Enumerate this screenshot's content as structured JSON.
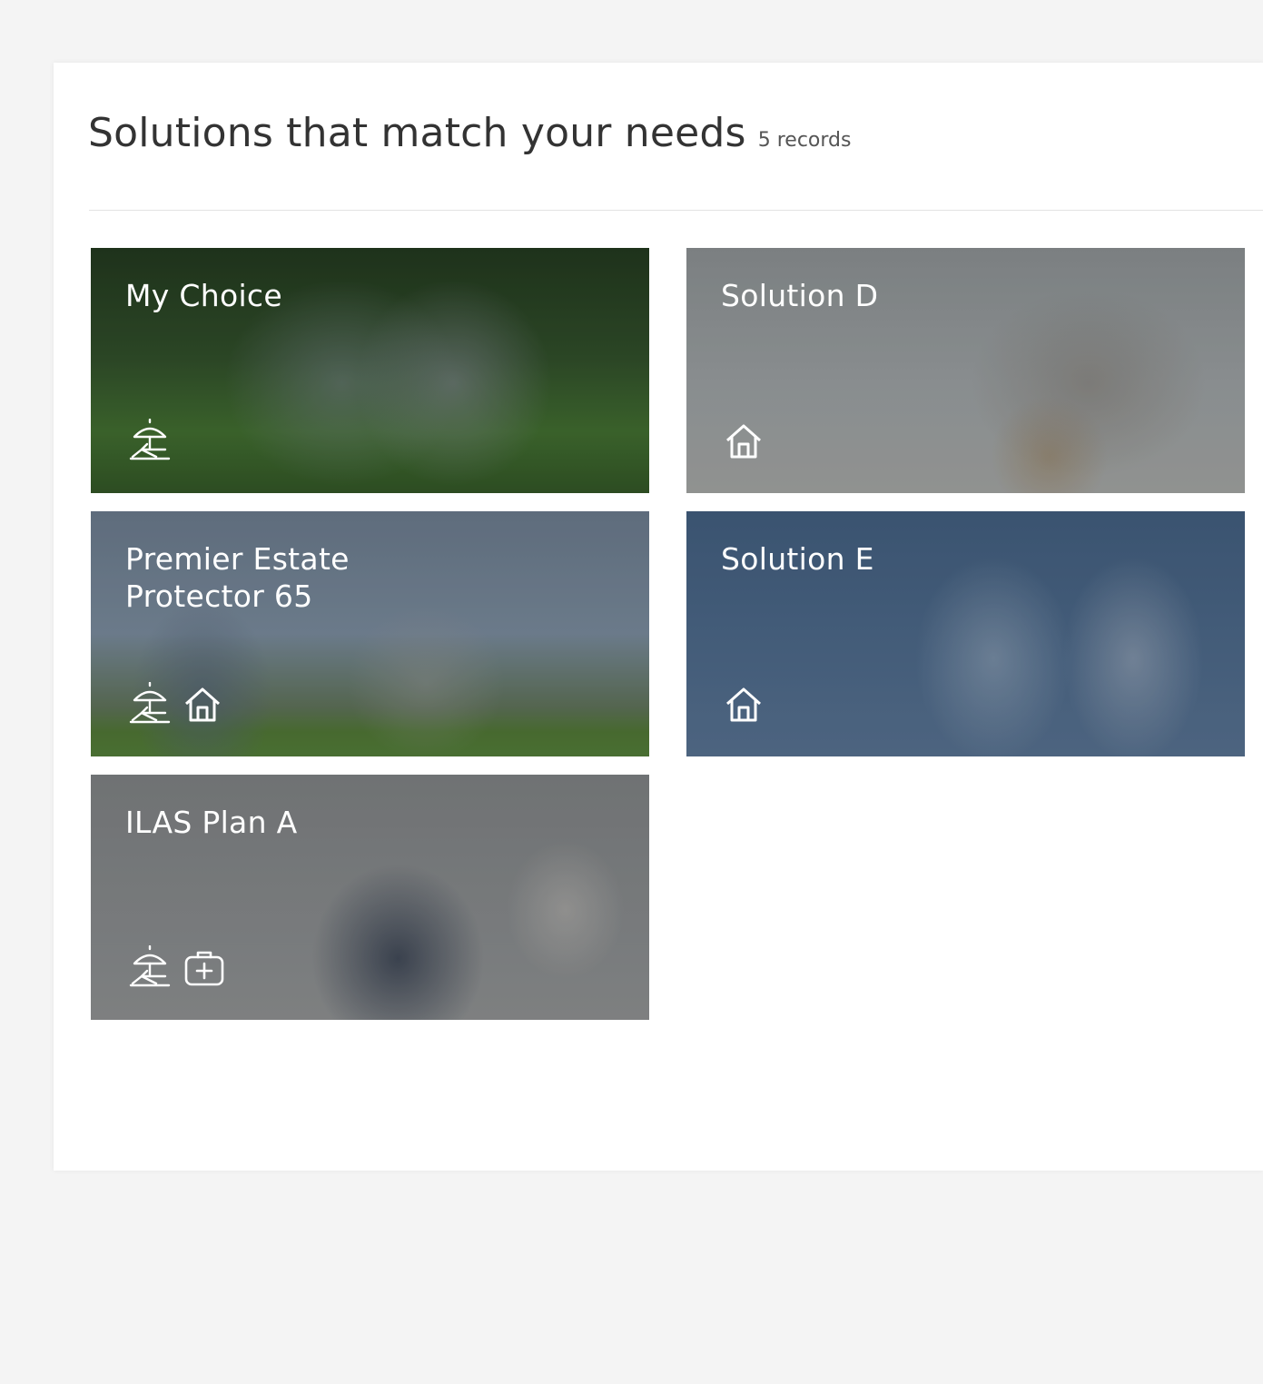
{
  "header": {
    "title": "Solutions that match your needs",
    "count": "5 records"
  },
  "cards": [
    {
      "name": "My Choice",
      "icons": [
        "beach-umbrella-icon"
      ]
    },
    {
      "name": "Solution D",
      "icons": [
        "house-icon"
      ]
    },
    {
      "name": "Premier Estate Protector 65",
      "icons": [
        "beach-umbrella-icon",
        "house-icon"
      ]
    },
    {
      "name": "Solution E",
      "icons": [
        "house-icon"
      ]
    },
    {
      "name": "ILAS Plan A",
      "icons": [
        "beach-umbrella-icon",
        "medical-kit-icon"
      ]
    }
  ],
  "colors": {
    "page_background": "#f4f4f4",
    "panel_background": "#ffffff",
    "title_text": "#333333",
    "card_text": "#ffffff"
  }
}
